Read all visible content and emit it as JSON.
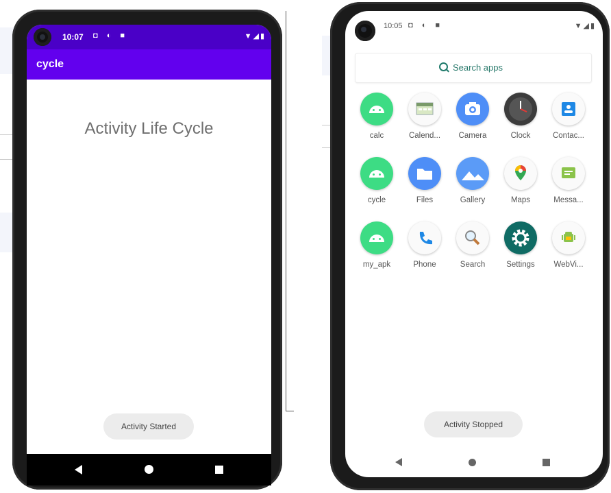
{
  "left_phone": {
    "status": {
      "time": "10:07",
      "notif_icons": "◘ ◐ ■",
      "system_icons": "▼◢▮"
    },
    "app_title": "cycle",
    "heading": "Activity Life Cycle",
    "toast": "Activity Started",
    "colors": {
      "status_bar": "#4a00c7",
      "app_bar": "#6200ee"
    }
  },
  "right_phone": {
    "status": {
      "time": "10:05",
      "notif_icons": "◘ ◐ ■",
      "system_icons": "▼◢▮"
    },
    "search_placeholder": "Search apps",
    "apps": [
      {
        "label": "calc",
        "icon": "android-icon"
      },
      {
        "label": "Calend...",
        "icon": "calendar-icon"
      },
      {
        "label": "Camera",
        "icon": "camera-icon"
      },
      {
        "label": "Clock",
        "icon": "clock-icon"
      },
      {
        "label": "Contac...",
        "icon": "contacts-icon"
      },
      {
        "label": "cycle",
        "icon": "android-icon"
      },
      {
        "label": "Files",
        "icon": "folder-icon"
      },
      {
        "label": "Gallery",
        "icon": "gallery-icon"
      },
      {
        "label": "Maps",
        "icon": "maps-pin-icon"
      },
      {
        "label": "Messa...",
        "icon": "messages-icon"
      },
      {
        "label": "my_apk",
        "icon": "android-icon"
      },
      {
        "label": "Phone",
        "icon": "phone-icon"
      },
      {
        "label": "Search",
        "icon": "magnifier-icon"
      },
      {
        "label": "Settings",
        "icon": "gear-icon"
      },
      {
        "label": "WebVi...",
        "icon": "webview-icon"
      }
    ],
    "toast": "Activity Stopped"
  }
}
